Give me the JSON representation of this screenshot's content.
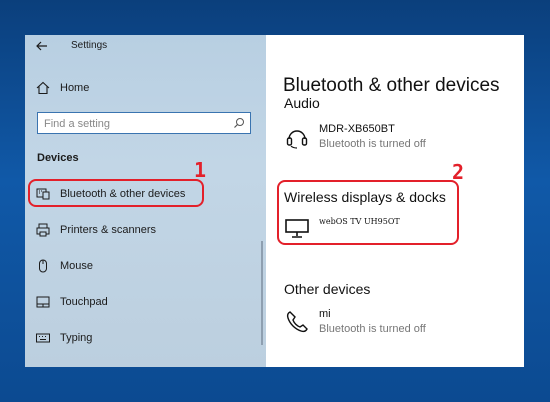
{
  "window": {
    "title": "Settings"
  },
  "sidebar": {
    "home_label": "Home",
    "search_placeholder": "Find a setting",
    "section_heading": "Devices",
    "items": [
      {
        "label": "Bluetooth & other devices",
        "icon": "bluetooth-devices-icon"
      },
      {
        "label": "Printers & scanners",
        "icon": "printer-icon"
      },
      {
        "label": "Mouse",
        "icon": "mouse-icon"
      },
      {
        "label": "Touchpad",
        "icon": "touchpad-icon"
      },
      {
        "label": "Typing",
        "icon": "keyboard-icon"
      }
    ]
  },
  "content": {
    "page_title": "Bluetooth & other devices",
    "clipped_heading": "Audio",
    "audio_devices": [
      {
        "name": "MDR-XB650BT",
        "status": "Bluetooth is turned off",
        "icon": "headphones-icon"
      }
    ],
    "wireless_heading": "Wireless displays & docks",
    "wireless_devices": [
      {
        "name": "webOS TV UH95OT",
        "icon": "monitor-icon"
      }
    ],
    "other_heading": "Other devices",
    "other_devices": [
      {
        "name": "mi",
        "status": "Bluetooth is turned off",
        "icon": "phone-icon"
      }
    ]
  },
  "annotations": {
    "marker1": "1",
    "marker2": "2",
    "color": "#e3202a"
  }
}
